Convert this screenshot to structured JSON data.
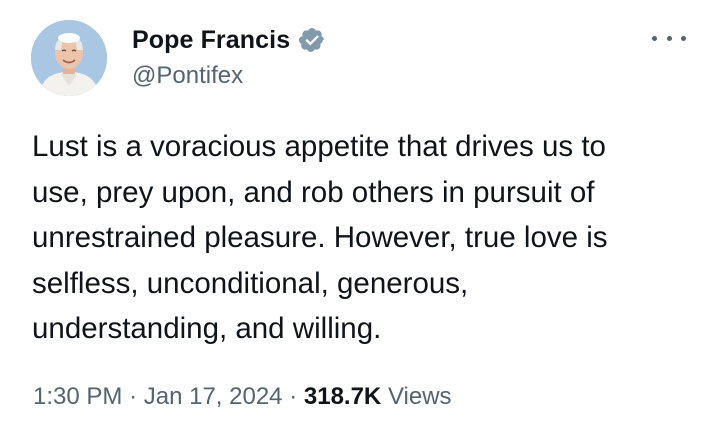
{
  "author": {
    "display_name": "Pope Francis",
    "handle": "@Pontifex",
    "verified": true,
    "verified_color": "#829aab"
  },
  "icons": {
    "verified": "verified-badge-icon",
    "more": "more-options-icon"
  },
  "tweet": {
    "text": "Lust is a voracious appetite that drives us to\nuse, prey upon, and rob others in pursuit of\nunrestrained pleasure. However, true love is\nselfless, unconditional, generous,\nunderstanding, and willing."
  },
  "meta": {
    "time": "1:30 PM",
    "separator": "·",
    "date": "Jan 17, 2024",
    "views_count": "318.7K",
    "views_label": "Views"
  },
  "colors": {
    "text": "#0f1419",
    "secondary": "#536471",
    "background": "#ffffff"
  }
}
